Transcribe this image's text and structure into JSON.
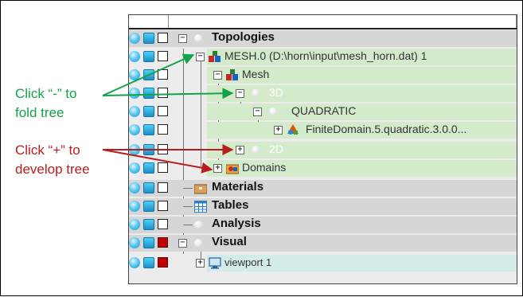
{
  "tree": {
    "rows": [
      {
        "label": "Topologies"
      },
      {
        "label": "MESH.0 (D:\\horn\\input\\mesh_horn.dat) 1"
      },
      {
        "label": "Mesh"
      },
      {
        "label": "3D"
      },
      {
        "label": "QUADRATIC"
      },
      {
        "label": "FiniteDomain.5.quadratic.3.0.0..."
      },
      {
        "label": "2D"
      },
      {
        "label": "Domains"
      },
      {
        "label": "Materials"
      },
      {
        "label": "Tables"
      },
      {
        "label": "Analysis"
      },
      {
        "label": "Visual"
      },
      {
        "label": "viewport 1"
      }
    ],
    "expanders": {
      "minus": "−",
      "plus": "+"
    }
  },
  "annotations": {
    "fold_line1": "Click “-” to",
    "fold_line2": "fold tree",
    "develop_line1": "Click “+” to",
    "develop_line2": "develop tree",
    "fold_color": "#13a34a",
    "develop_color": "#b81c1c"
  },
  "colors": {
    "highlight_green": "#d4ebcb",
    "highlight_blue": "#d2ece9",
    "panel_gray": "#ececec"
  },
  "icons": {
    "status": [
      "bulb-icon",
      "visibility-square-icon",
      "checkbox-square-icon"
    ],
    "mesh": "colored-blocks-icon",
    "domain": "triangle-shapes-icon",
    "domains": "folder-shapes-icon",
    "materials": "box-icon",
    "tables": "table-grid-icon",
    "viewport": "monitor-icon",
    "node": "sphere-icon"
  }
}
